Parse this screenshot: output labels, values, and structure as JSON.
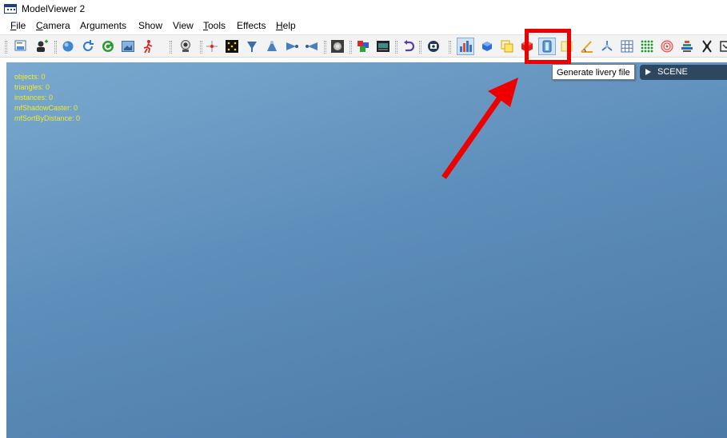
{
  "window": {
    "title": "ModelViewer 2"
  },
  "menu": [
    {
      "label": "File",
      "mnemonic": "F",
      "rest": "ile"
    },
    {
      "label": "Camera",
      "mnemonic": "C",
      "rest": "amera"
    },
    {
      "label": "Arguments",
      "mnemonic": "",
      "rest": "Arguments"
    },
    {
      "label": "Show",
      "mnemonic": "",
      "rest": "Show"
    },
    {
      "label": "View",
      "mnemonic": "",
      "rest": "View"
    },
    {
      "label": "Tools",
      "mnemonic": "T",
      "rest": "ools"
    },
    {
      "label": "Effects",
      "mnemonic": "",
      "rest": "Effects"
    },
    {
      "label": "Help",
      "mnemonic": "H",
      "rest": "elp"
    }
  ],
  "stats": [
    "objects: 0",
    "triangles: 0",
    "instances: 0",
    "mfShadowCaster: 0",
    "mfSortByDistance: 0"
  ],
  "tooltip": "Generate livery file",
  "scene_tab": "SCENE",
  "colors": {
    "stats_text": "#f2ea2c",
    "annotation_red": "#ee0000",
    "viewport_top": "#7aa9cf",
    "viewport_bottom": "#4c79a6"
  },
  "toolbar_icons": [
    "open-model-icon",
    "add-user-icon",
    "sphere-icon",
    "refresh-icon",
    "reload-green-icon",
    "export-image-icon",
    "animation-icon",
    "webcam-icon",
    "axis-cross-icon",
    "grid-dots-icon",
    "light-cone-icon",
    "light-down-icon",
    "light-right-icon",
    "light-left-icon",
    "texture-preview-icon",
    "color-cubes-icon",
    "film-strip-icon",
    "undo-icon",
    "screenshot-icon",
    "statistics-bars-icon",
    "blue-cube-icon",
    "copy-objects-icon",
    "red-cube-icon",
    "generate-livery-icon",
    "yellow-square-icon",
    "measure-angle-icon",
    "transform-axes-icon",
    "grid-icon",
    "green-dots-icon",
    "target-icon",
    "layers-stack-icon",
    "settings-tool-icon"
  ]
}
